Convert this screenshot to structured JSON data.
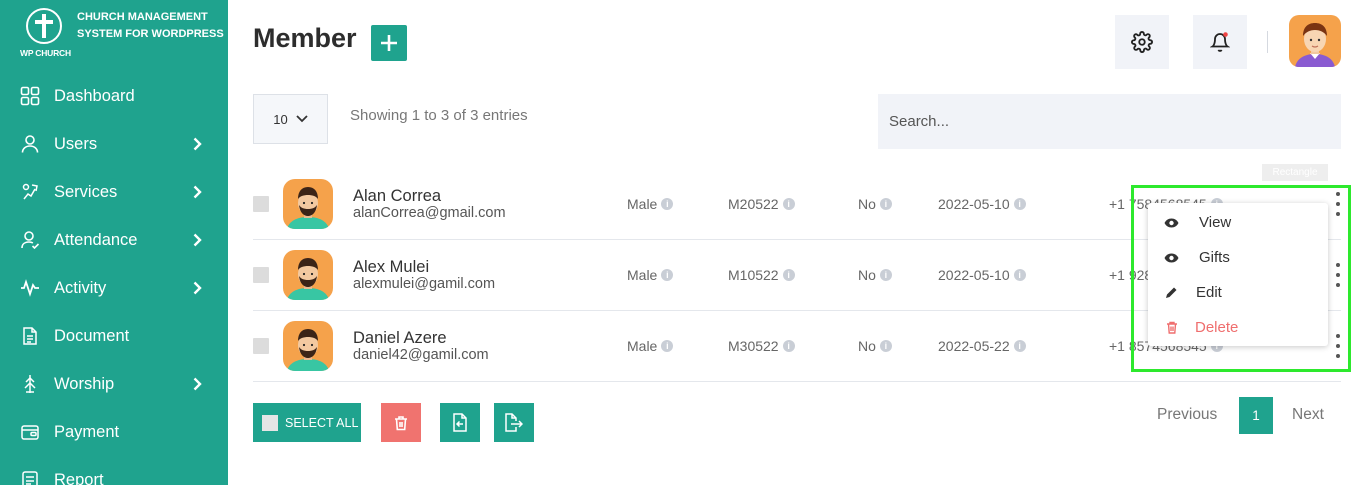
{
  "brand": {
    "logo_text": "WP CHURCH",
    "title": "CHURCH MANAGEMENT SYSTEM FOR WORDPRESS"
  },
  "sidebar": {
    "items": [
      {
        "label": "Dashboard",
        "icon": "dashboard-grid-icon",
        "has_submenu": false
      },
      {
        "label": "Users",
        "icon": "user-icon",
        "has_submenu": true
      },
      {
        "label": "Services",
        "icon": "services-icon",
        "has_submenu": true
      },
      {
        "label": "Attendance",
        "icon": "attendance-icon",
        "has_submenu": true
      },
      {
        "label": "Activity",
        "icon": "activity-pulse-icon",
        "has_submenu": true
      },
      {
        "label": "Document",
        "icon": "document-icon",
        "has_submenu": false
      },
      {
        "label": "Worship",
        "icon": "worship-icon",
        "has_submenu": true
      },
      {
        "label": "Payment",
        "icon": "payment-icon",
        "has_submenu": false
      },
      {
        "label": "Report",
        "icon": "report-icon",
        "has_submenu": false
      }
    ]
  },
  "header": {
    "title": "Member"
  },
  "table_controls": {
    "page_length": "10",
    "entries_info": "Showing 1 to 3 of 3 entries",
    "search_placeholder": "Search..."
  },
  "tooltip_tag": "Rectangle",
  "members": [
    {
      "name": "Alan Correa",
      "email": "alanCorrea@gmail.com",
      "gender": "Male",
      "member_id": "M20522",
      "flag": "No",
      "date": "2022-05-10",
      "phone": "+1 7584568545"
    },
    {
      "name": "Alex Mulei",
      "email": "alexmulei@gamil.com",
      "gender": "Male",
      "member_id": "M10522",
      "flag": "No",
      "date": "2022-05-10",
      "phone": "+1 9284568545"
    },
    {
      "name": "Daniel Azere",
      "email": "daniel42@gamil.com",
      "gender": "Male",
      "member_id": "M30522",
      "flag": "No",
      "date": "2022-05-22",
      "phone": "+1 8574568545"
    }
  ],
  "row_menu": {
    "view": "View",
    "gifts": "Gifts",
    "edit": "Edit",
    "delete": "Delete"
  },
  "footer": {
    "select_all": "SELECT ALL",
    "prev": "Previous",
    "page": "1",
    "next": "Next"
  },
  "colors": {
    "accent": "#1fa38e",
    "danger": "#f0736f",
    "highlight": "#2de92d"
  }
}
